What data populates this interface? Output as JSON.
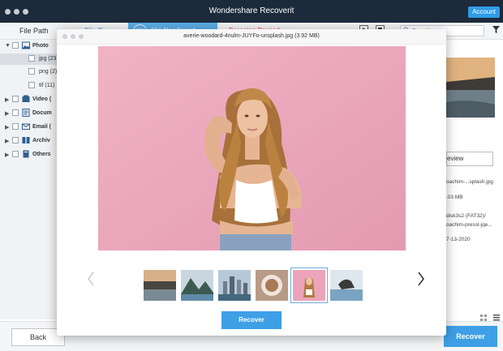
{
  "window": {
    "title": "Wondershare Recoverit",
    "account_label": "Account"
  },
  "toolbar": {
    "tabs": [
      {
        "label": "File Path"
      },
      {
        "label": "File Type"
      }
    ],
    "progress_percent": "13%",
    "files_found": "216 files Found",
    "scan_status": "Scanning Paused.",
    "search_placeholder": "Search"
  },
  "sidebar": {
    "items": [
      {
        "label": "Photo"
      },
      {
        "label": "jpg (23)"
      },
      {
        "label": "png (2)"
      },
      {
        "label": "tif (11)"
      },
      {
        "label": "Video ("
      },
      {
        "label": "Docum"
      },
      {
        "label": "Email ("
      },
      {
        "label": "Archiv"
      },
      {
        "label": "Others"
      }
    ]
  },
  "details": {
    "preview_button": "Preview",
    "name": "oachim-...splash.jpg",
    "size": ".03 MB",
    "path_line1": "disk3s2 (FAT32)/",
    "path_line2": "oachim-pressl-jqe...",
    "date": "7-13-2020"
  },
  "footer": {
    "back_label": "Back",
    "recover_label": "Recover"
  },
  "preview_dialog": {
    "filename": "averie-woodard-4nulm-JUYFo-unsplash.jpg (3.92 MB)",
    "recover_label": "Recover",
    "thumbnail_count": 6,
    "selected_thumbnail": 5
  },
  "colors": {
    "titlebar": "#1c2a3b",
    "accent": "#3f9fe6",
    "paused_red": "#e53935",
    "photo_background": "#eba4ba"
  }
}
